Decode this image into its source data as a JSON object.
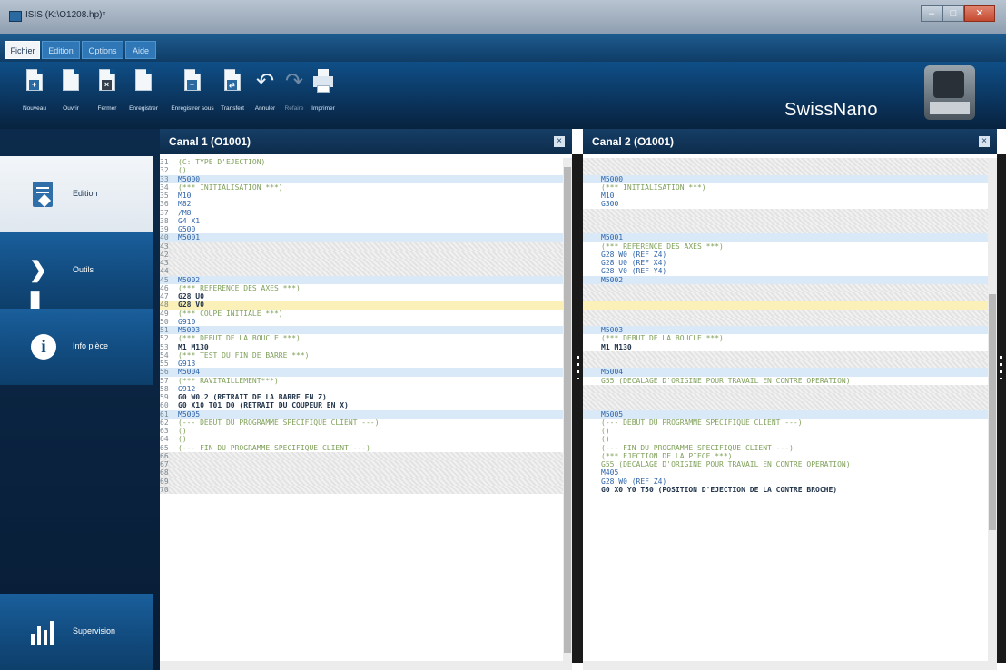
{
  "window": {
    "title": "ISIS (K:\\O1208.hp)*"
  },
  "menu": {
    "tabs": [
      "Fichier",
      "Edition",
      "Options",
      "Aide"
    ]
  },
  "toolbar": {
    "items": [
      "Nouveau",
      "Ouvrir",
      "Fermer",
      "Enregistrer",
      "Enregistrer sous",
      "Transfert",
      "Annuler",
      "Refaire",
      "Imprimer"
    ],
    "disabled": [
      "Refaire"
    ]
  },
  "brand": "SwissNano",
  "sidebar": {
    "items": [
      "Edition",
      "Outils",
      "Info pièce",
      "Supervision"
    ],
    "active": "Edition"
  },
  "panels": [
    {
      "title": "Canal 1 (O1001)",
      "lines": [
        {
          "n": "31",
          "text": "(C: TYPE D'EJECTION)",
          "style": "white",
          "color": "green"
        },
        {
          "n": "32",
          "text": "()",
          "style": "white",
          "color": "green"
        },
        {
          "n": "33",
          "text": "M5000",
          "style": "blue",
          "color": "blue"
        },
        {
          "n": "34",
          "text": "(*** INITIALISATION ***)",
          "style": "white",
          "color": "green"
        },
        {
          "n": "35",
          "text": "M10",
          "style": "white",
          "color": "blue"
        },
        {
          "n": "36",
          "text": "M82",
          "style": "white",
          "color": "blue"
        },
        {
          "n": "37",
          "text": "/M8",
          "style": "white",
          "color": "blue"
        },
        {
          "n": "38",
          "text": "G4 X1",
          "style": "white",
          "color": "blue"
        },
        {
          "n": "39",
          "text": "G500",
          "style": "white",
          "color": "blue"
        },
        {
          "n": "40",
          "text": "M5001",
          "style": "blue",
          "color": "blue"
        },
        {
          "n": "43",
          "text": "",
          "style": "hatch",
          "color": "blue"
        },
        {
          "n": "42",
          "text": "",
          "style": "hatch",
          "color": "blue"
        },
        {
          "n": "43",
          "text": "",
          "style": "hatch",
          "color": "blue"
        },
        {
          "n": "44",
          "text": "",
          "style": "hatch",
          "color": "blue"
        },
        {
          "n": "45",
          "text": "M5002",
          "style": "blue",
          "color": "blue"
        },
        {
          "n": "46",
          "text": "(*** REFERENCE DES AXES ***)",
          "style": "white",
          "color": "green"
        },
        {
          "n": "47",
          "text": "G28 U0",
          "style": "white",
          "color": "dark"
        },
        {
          "n": "48",
          "text": "G28 V0",
          "style": "cur",
          "color": "dark"
        },
        {
          "n": "49",
          "text": "(*** COUPE INITIALE ***)",
          "style": "white",
          "color": "green"
        },
        {
          "n": "50",
          "text": "G910",
          "style": "white",
          "color": "blue"
        },
        {
          "n": "51",
          "text": "M5003",
          "style": "blue",
          "color": "blue"
        },
        {
          "n": "52",
          "text": "(*** DEBUT DE LA BOUCLE ***)",
          "style": "white",
          "color": "green"
        },
        {
          "n": "53",
          "text": "M1 M130",
          "style": "white",
          "color": "dark"
        },
        {
          "n": "54",
          "text": "(*** TEST DU FIN DE BARRE ***)",
          "style": "white",
          "color": "green"
        },
        {
          "n": "55",
          "text": "G913",
          "style": "white",
          "color": "blue"
        },
        {
          "n": "56",
          "text": "M5004",
          "style": "blue",
          "color": "blue"
        },
        {
          "n": "57",
          "text": "(*** RAVITAILLEMENT***)",
          "style": "white",
          "color": "green"
        },
        {
          "n": "58",
          "text": "G912",
          "style": "white",
          "color": "blue"
        },
        {
          "n": "59",
          "text": "G0 W0.2 (RETRAIT DE LA BARRE EN Z)",
          "style": "white",
          "color": "dark"
        },
        {
          "n": "60",
          "text": "G0 X10 T01 D0 (RETRAIT DU COUPEUR EN X)",
          "style": "white",
          "color": "dark"
        },
        {
          "n": "61",
          "text": "M5005",
          "style": "blue",
          "color": "blue"
        },
        {
          "n": "62",
          "text": "(--- DEBUT DU PROGRAMME SPECIFIQUE CLIENT ---)",
          "style": "white",
          "color": "green"
        },
        {
          "n": "63",
          "text": "()",
          "style": "white",
          "color": "green"
        },
        {
          "n": "64",
          "text": "()",
          "style": "white",
          "color": "green"
        },
        {
          "n": "65",
          "text": "(--- FIN DU PROGRAMME SPECIFIQUE CLIENT ---)",
          "style": "white",
          "color": "green"
        },
        {
          "n": "66",
          "text": "",
          "style": "hatch",
          "color": "blue"
        },
        {
          "n": "67",
          "text": "",
          "style": "hatch",
          "color": "blue"
        },
        {
          "n": "68",
          "text": "",
          "style": "hatch",
          "color": "blue"
        },
        {
          "n": "69",
          "text": "",
          "style": "hatch",
          "color": "blue"
        },
        {
          "n": "70",
          "text": "",
          "style": "hatch",
          "color": "blue"
        }
      ]
    },
    {
      "title": "Canal 2 (O1001)",
      "lines": [
        {
          "n": "",
          "text": "",
          "style": "hatch",
          "color": "blue"
        },
        {
          "n": "",
          "text": "",
          "style": "hatch",
          "color": "blue"
        },
        {
          "n": "",
          "text": "M5000",
          "style": "blue",
          "color": "blue"
        },
        {
          "n": "",
          "text": "(*** INITIALISATION ***)",
          "style": "white",
          "color": "green"
        },
        {
          "n": "",
          "text": "M10",
          "style": "white",
          "color": "blue"
        },
        {
          "n": "",
          "text": "G300",
          "style": "white",
          "color": "blue"
        },
        {
          "n": "",
          "text": "",
          "style": "hatch",
          "color": "blue"
        },
        {
          "n": "",
          "text": "",
          "style": "hatch",
          "color": "blue"
        },
        {
          "n": "",
          "text": "",
          "style": "hatch",
          "color": "blue"
        },
        {
          "n": "",
          "text": "M5001",
          "style": "blue",
          "color": "blue"
        },
        {
          "n": "",
          "text": "(*** REFERENCE DES AXES ***)",
          "style": "white",
          "color": "green"
        },
        {
          "n": "",
          "text": "G28 W0 (REF Z4)",
          "style": "white",
          "color": "blue"
        },
        {
          "n": "",
          "text": "G28 U0 (REF X4)",
          "style": "white",
          "color": "blue"
        },
        {
          "n": "",
          "text": "G28 V0 (REF Y4)",
          "style": "white",
          "color": "blue"
        },
        {
          "n": "",
          "text": "M5002",
          "style": "blue",
          "color": "blue"
        },
        {
          "n": "",
          "text": "",
          "style": "hatch",
          "color": "blue"
        },
        {
          "n": "",
          "text": "",
          "style": "hatch",
          "color": "blue"
        },
        {
          "n": "",
          "text": "",
          "style": "cur",
          "color": "blue"
        },
        {
          "n": "",
          "text": "",
          "style": "hatch",
          "color": "blue"
        },
        {
          "n": "",
          "text": "",
          "style": "hatch",
          "color": "blue"
        },
        {
          "n": "",
          "text": "M5003",
          "style": "blue",
          "color": "blue"
        },
        {
          "n": "",
          "text": "(*** DEBUT DE LA BOUCLE ***)",
          "style": "white",
          "color": "green"
        },
        {
          "n": "",
          "text": "M1 M130",
          "style": "white",
          "color": "dark"
        },
        {
          "n": "",
          "text": "",
          "style": "hatch",
          "color": "blue"
        },
        {
          "n": "",
          "text": "",
          "style": "hatch",
          "color": "blue"
        },
        {
          "n": "",
          "text": "M5004",
          "style": "blue",
          "color": "blue"
        },
        {
          "n": "",
          "text": "G55 (DECALAGE D'ORIGINE POUR TRAVAIL EN CONTRE OPERATION)",
          "style": "white",
          "color": "green"
        },
        {
          "n": "",
          "text": "",
          "style": "hatch",
          "color": "blue"
        },
        {
          "n": "",
          "text": "",
          "style": "hatch",
          "color": "blue"
        },
        {
          "n": "",
          "text": "",
          "style": "hatch",
          "color": "blue"
        },
        {
          "n": "",
          "text": "M5005",
          "style": "blue",
          "color": "blue"
        },
        {
          "n": "",
          "text": "(--- DEBUT DU PROGRAMME SPECIFIQUE CLIENT ---)",
          "style": "white",
          "color": "green"
        },
        {
          "n": "",
          "text": "()",
          "style": "white",
          "color": "green"
        },
        {
          "n": "",
          "text": "()",
          "style": "white",
          "color": "green"
        },
        {
          "n": "",
          "text": "(--- FIN DU PROGRAMME SPECIFIQUE CLIENT ---)",
          "style": "white",
          "color": "green"
        },
        {
          "n": "",
          "text": "(*** EJECTION DE LA PIECE ***)",
          "style": "white",
          "color": "green"
        },
        {
          "n": "",
          "text": "G55 (DECALAGE D'ORIGINE POUR TRAVAIL EN CONTRE OPERATION)",
          "style": "white",
          "color": "green"
        },
        {
          "n": "",
          "text": "M405",
          "style": "white",
          "color": "blue"
        },
        {
          "n": "",
          "text": "G28 W0 (REF Z4)",
          "style": "white",
          "color": "blue"
        },
        {
          "n": "",
          "text": "G0 X0 Y0 T50 (POSITION D'EJECTION DE LA CONTRE BROCHE)",
          "style": "white",
          "color": "dark"
        }
      ]
    }
  ]
}
